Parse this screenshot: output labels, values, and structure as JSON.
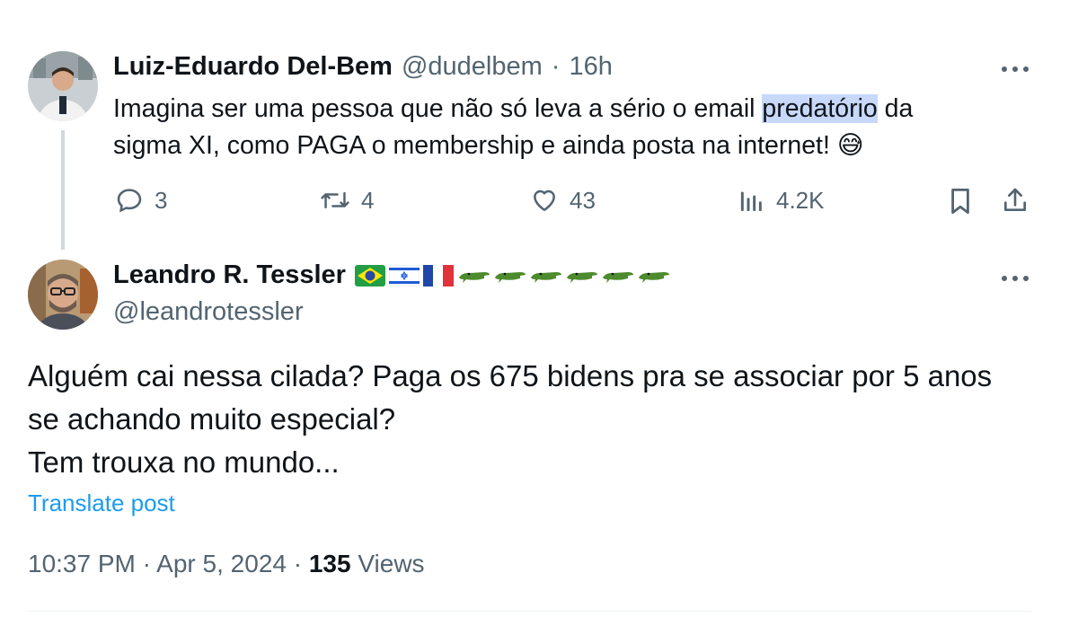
{
  "reply_tweet": {
    "author_name": "Luiz-Eduardo Del-Bem",
    "handle": "@dudelbem",
    "separator": "·",
    "time": "16h",
    "text_before": "Imagina ser uma pessoa que não só leva a sério o email ",
    "text_highlight": "predatório",
    "text_after_line1": " da",
    "text_line2": "sigma XI, como PAGA o membership e ainda posta na internet! ",
    "emoji": "😅",
    "actions": {
      "replies": "3",
      "reposts": "4",
      "likes": "43",
      "views": "4.2K"
    }
  },
  "main_tweet": {
    "author_name": "Leandro R. Tessler",
    "name_decorations": [
      "brazil-flag",
      "israel-flag",
      "france-flag",
      "crocodile",
      "crocodile",
      "crocodile",
      "crocodile",
      "crocodile",
      "crocodile"
    ],
    "handle": "@leandrotessler",
    "text_line1": "Alguém cai nessa cilada? Paga os 675 bidens pra se associar por 5 anos",
    "text_line2": "se achando muito especial?",
    "text_line3": "Tem trouxa no mundo...",
    "translate_label": "Translate post",
    "timestamp": "10:37 PM · Apr 5, 2024",
    "meta_separator": "·",
    "views_count": "135",
    "views_label": "Views"
  },
  "colors": {
    "text": "#0f1419",
    "secondary": "#536471",
    "link": "#1d9bf0",
    "highlight": "#c7d8fb",
    "thread_line": "#cfd9de"
  }
}
